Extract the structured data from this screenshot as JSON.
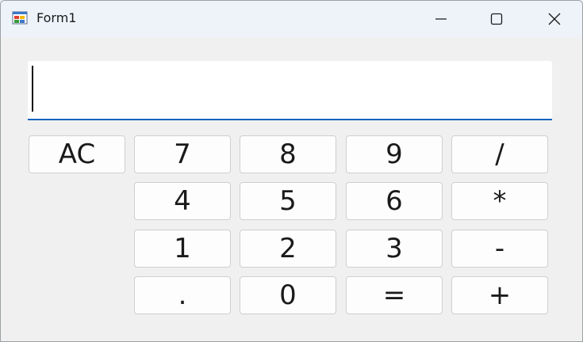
{
  "window": {
    "title": "Form1"
  },
  "display": {
    "value": ""
  },
  "keys": {
    "clear": "AC",
    "seven": "7",
    "eight": "8",
    "nine": "9",
    "divide": "/",
    "four": "4",
    "five": "5",
    "six": "6",
    "multiply": "*",
    "one": "1",
    "two": "2",
    "three": "3",
    "subtract": "-",
    "decimal": ".",
    "zero": "0",
    "equals": "=",
    "add": "+"
  },
  "colors": {
    "accent": "#1565c0",
    "background": "#f0f0f0",
    "titlebar": "#eef3fa"
  }
}
